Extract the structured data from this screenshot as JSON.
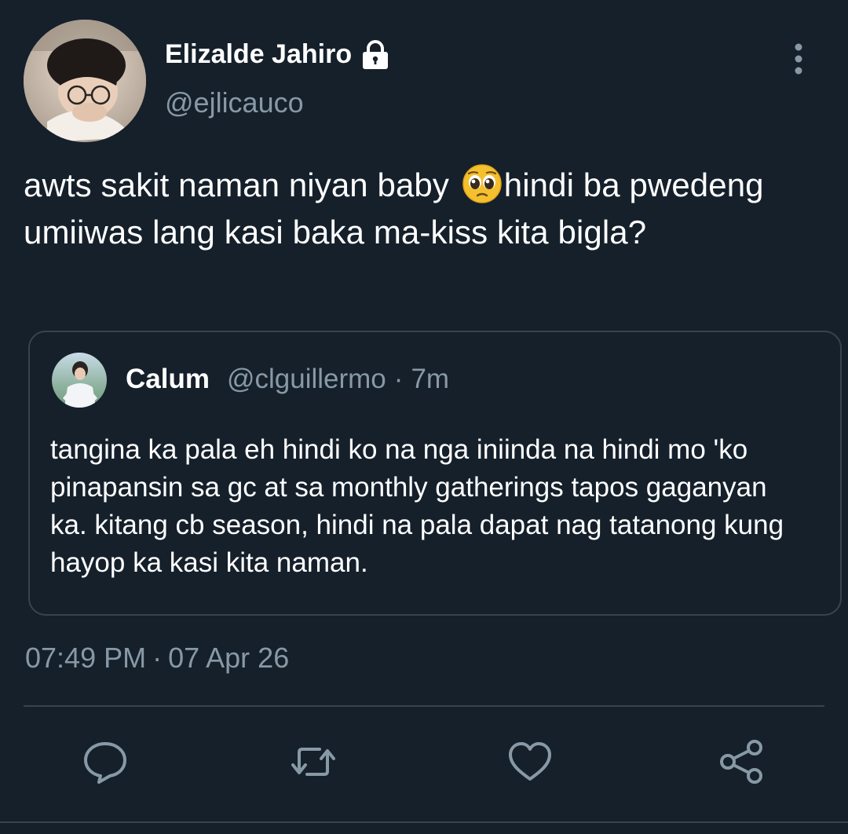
{
  "tweet": {
    "display_name": "Elizalde Jahiro",
    "handle": "@ejlicauco",
    "text_before_emoji": "awts sakit naman niyan baby ",
    "emoji": "pleading-face",
    "text_after_emoji": "hindi ba pwedeng umiiwas lang kasi baka ma-kiss kita bigla?",
    "time": "07:49 PM",
    "separator": "·",
    "date": "07 Apr 26",
    "protected_icon": "lock-icon",
    "menu_icon": "more-vertical-icon"
  },
  "quoted_tweet": {
    "display_name": "Calum",
    "handle": "@clguillermo",
    "separator": "·",
    "time_ago": "7m",
    "text": "tangina ka pala eh hindi ko na nga iniinda na hindi mo 'ko pinapansin sa gc at sa monthly gatherings tapos gaganyan ka. kitang cb season, hindi na pala dapat nag tatanong kung hayop ka kasi kita naman."
  },
  "actions": [
    {
      "name": "reply",
      "icon": "reply-icon"
    },
    {
      "name": "retweet",
      "icon": "retweet-icon"
    },
    {
      "name": "like",
      "icon": "heart-icon"
    },
    {
      "name": "share",
      "icon": "share-icon"
    }
  ],
  "colors": {
    "background": "#15202b",
    "text_primary": "#ffffff",
    "text_secondary": "#8899a6",
    "border": "#38444d"
  }
}
